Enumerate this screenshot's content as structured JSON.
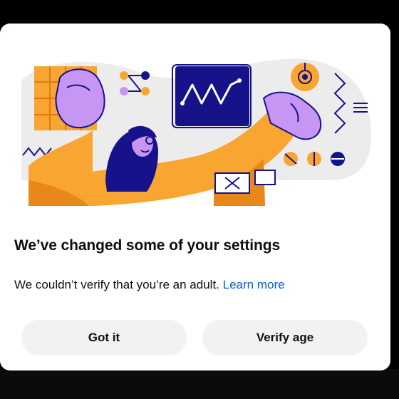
{
  "dialog": {
    "title": "We’ve changed some of your settings",
    "message": "We couldn’t verify that you’re an adult.",
    "learn_more": "Learn more",
    "buttons": {
      "got_it": "Got it",
      "verify_age": "Verify age"
    }
  },
  "illustration": {
    "description_icons": [
      "person-icon",
      "monitor-chart-icon",
      "dial-icon",
      "close-box-icon",
      "slider-dots-icon"
    ],
    "colors": {
      "orange": "#f9a531",
      "purple": "#c796f5",
      "navy": "#16128a",
      "gray_bg": "#ececec"
    }
  }
}
